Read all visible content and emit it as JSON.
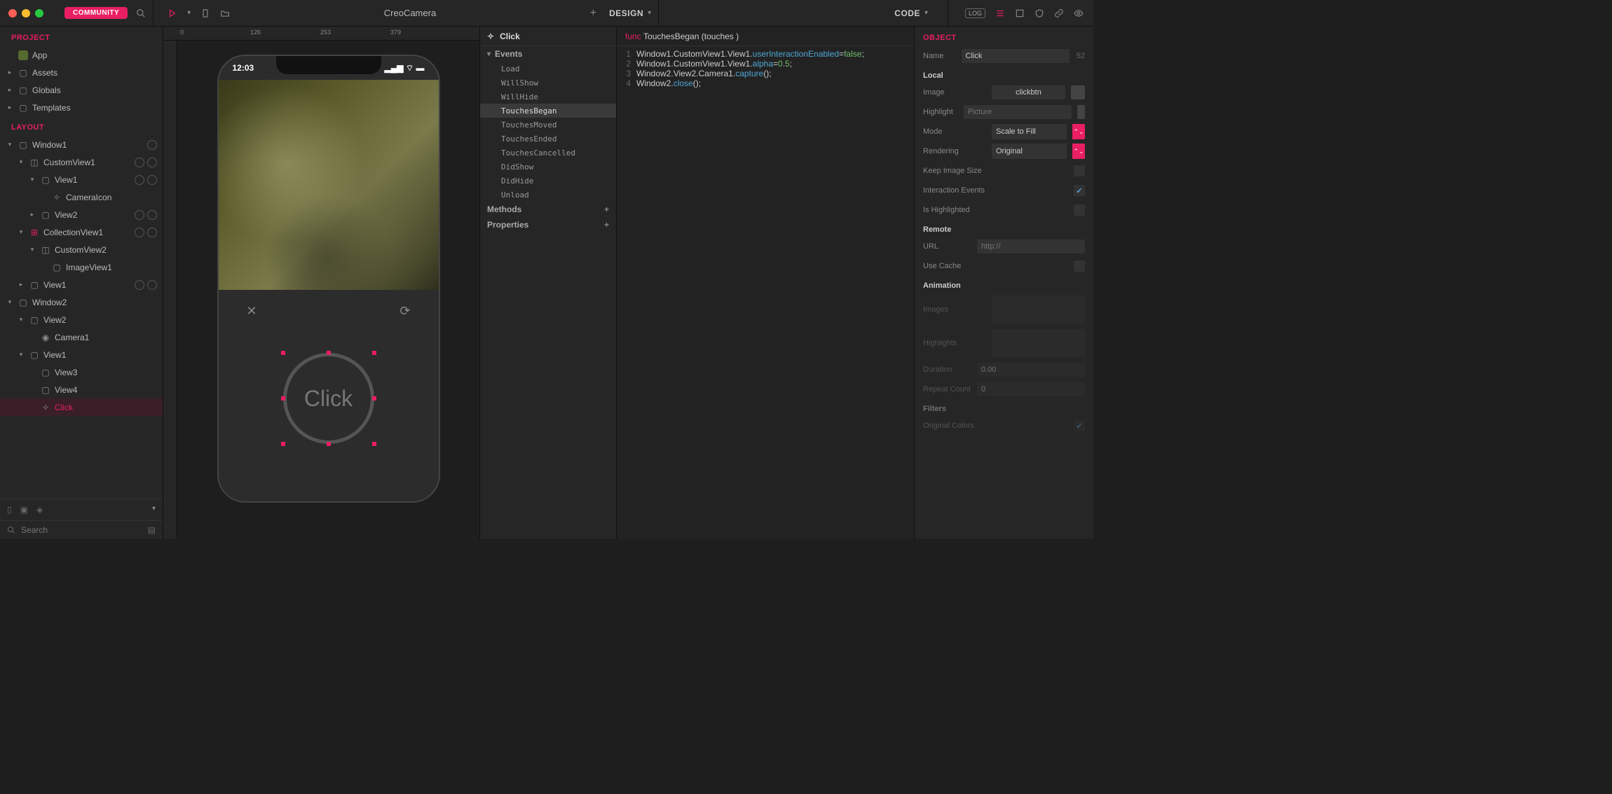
{
  "titlebar": {
    "community": "COMMUNITY",
    "project_name": "CreoCamera",
    "design_label": "DESIGN",
    "code_label": "CODE",
    "log_label": "LOG"
  },
  "sidebar": {
    "project_header": "PROJECT",
    "layout_header": "LAYOUT",
    "nodes": {
      "app": "App",
      "assets": "Assets",
      "globals": "Globals",
      "templates": "Templates",
      "window1": "Window1",
      "customview1": "CustomView1",
      "view1": "View1",
      "cameraicon": "CameraIcon",
      "view2": "View2",
      "collectionview1": "CollectionView1",
      "customview2": "CustomView2",
      "imageview1": "ImageView1",
      "view1b": "View1",
      "window2": "Window2",
      "view2b": "View2",
      "camera1": "Camera1",
      "view1c": "View1",
      "view3": "View3",
      "view4": "View4",
      "click": "Click"
    },
    "search_placeholder": "Search"
  },
  "canvas": {
    "ruler_marks": [
      "0",
      "126",
      "253",
      "379"
    ],
    "status_time": "12:03",
    "click_label": "Click"
  },
  "outline": {
    "title": "Click",
    "events_label": "Events",
    "methods_label": "Methods",
    "properties_label": "Properties",
    "events": [
      "Load",
      "WillShow",
      "WillHide",
      "TouchesBegan",
      "TouchesMoved",
      "TouchesEnded",
      "TouchesCancelled",
      "DidShow",
      "DidHide",
      "Unload"
    ],
    "selected_event": "TouchesBegan"
  },
  "code": {
    "signature_kw": "func",
    "signature_name": "TouchesBegan",
    "signature_args": "(touches )",
    "lines": [
      {
        "n": "1",
        "txt": "Window1.CustomView1.View1.",
        "prop": "userInteractionEnabled",
        "after": " = ",
        "val": "false",
        "semi": ";"
      },
      {
        "n": "2",
        "txt": "Window1.CustomView1.View1.",
        "prop": "alpha",
        "after": " = ",
        "val": "0.5",
        "semi": ";"
      },
      {
        "n": "3",
        "txt": "Window2.View2.Camera1.",
        "prop": "capture",
        "after": "();",
        "val": "",
        "semi": ""
      },
      {
        "n": "4",
        "txt": "Window2.",
        "prop": "close",
        "after": "();",
        "val": "",
        "semi": ""
      }
    ]
  },
  "inspector": {
    "header": "OBJECT",
    "name_label": "Name",
    "name_value": "Click",
    "name_dim": "52",
    "local_section": "Local",
    "image_label": "Image",
    "image_value": "clickbtn",
    "highlight_label": "Highlight",
    "highlight_placeholder": "Picture",
    "mode_label": "Mode",
    "mode_value": "Scale to Fill",
    "rendering_label": "Rendering",
    "rendering_value": "Original",
    "keep_image_size_label": "Keep Image Size",
    "interaction_events_label": "Interaction Events",
    "is_highlighted_label": "Is Highlighted",
    "remote_section": "Remote",
    "url_label": "URL",
    "url_placeholder": "http://",
    "use_cache_label": "Use Cache",
    "animation_section": "Animation",
    "images_label": "Images",
    "highlights_label": "Highlights",
    "duration_label": "Duration",
    "duration_value": "0.00",
    "repeat_label": "Repeat Count",
    "repeat_value": "0",
    "filters_section": "Filters",
    "original_colors_label": "Original Colors"
  }
}
